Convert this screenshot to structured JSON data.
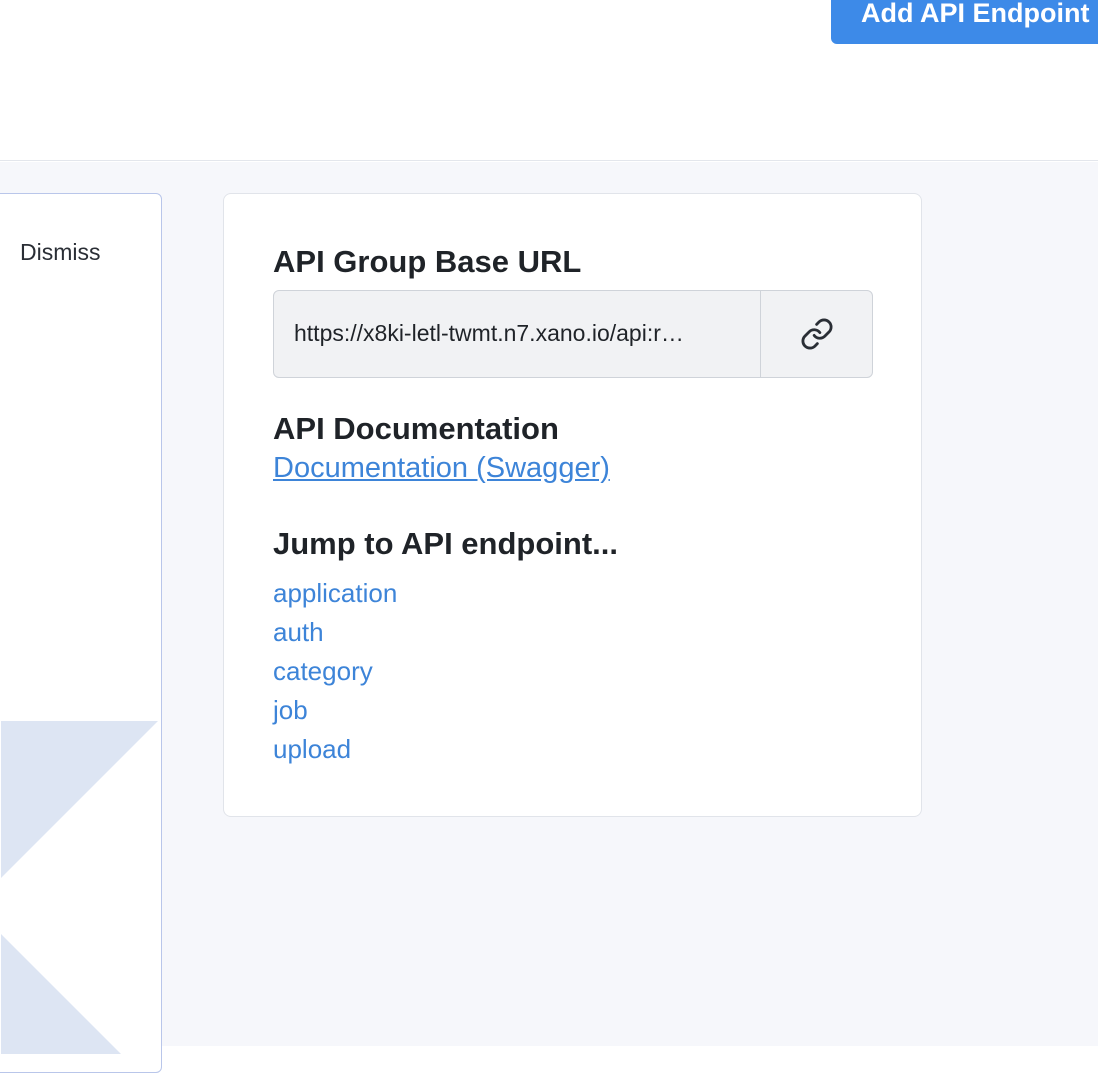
{
  "header": {
    "add_endpoint_label": "Add API Endpoint"
  },
  "left_panel": {
    "dismiss_label": "Dismiss"
  },
  "info_card": {
    "base_url_heading": "API Group Base URL",
    "base_url_value": "https://x8ki-letl-twmt.n7.xano.io/api:r…",
    "copy_icon": "link-icon",
    "documentation_heading": "API Documentation",
    "documentation_link": "Documentation (Swagger)",
    "jump_heading": "Jump to API endpoint...",
    "endpoints": [
      "application",
      "auth",
      "category",
      "job",
      "upload"
    ]
  },
  "colors": {
    "accent": "#3d8ae8",
    "link": "#3d84d8",
    "background": "#f6f7fb",
    "panel_border": "#b9c6ea",
    "shape_fill": "#dde5f3"
  }
}
